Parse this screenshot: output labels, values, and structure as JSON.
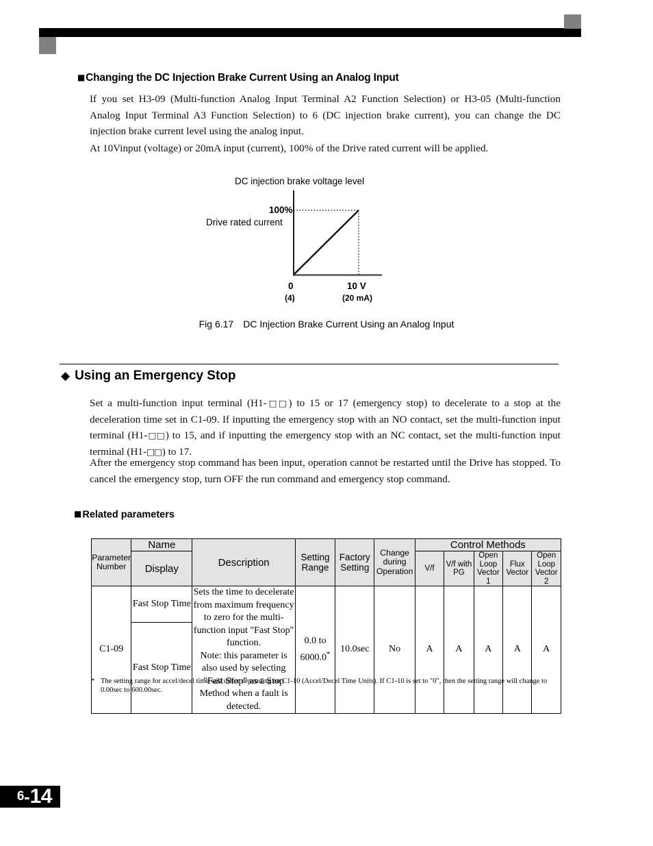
{
  "page": {
    "footer_chapter": "6",
    "footer_dash": "-",
    "footer_number": "14"
  },
  "section_analog": {
    "heading": "Changing the DC Injection Brake Current Using an Analog Input",
    "paragraph_1": "If you set H3-09 (Multi-function Analog Input Terminal A2 Function Selection) or H3-05 (Multi-function Analog Input Terminal A3 Function Selection) to 6 (DC injection brake current), you can change the DC injection brake current level using the analog input.",
    "paragraph_2": "At 10Vinput (voltage) or 20mA input (current), 100% of the Drive rated current will be applied."
  },
  "figure": {
    "caption_number": "Fig 6.17",
    "caption_text": "DC Injection Brake Current Using an Analog Input",
    "title": "DC injection brake voltage level",
    "y_label_value": "100%",
    "y_label_text": "Drive rated current",
    "x_label_0": "0",
    "x_label_0_alt": "(4)",
    "x_label_max": "10  V",
    "x_label_max_alt": "(20 mA)"
  },
  "chart_data": {
    "type": "line",
    "title": "DC injection brake voltage level",
    "xlabel": "",
    "ylabel": "Drive rated current",
    "x": [
      0,
      10
    ],
    "values": [
      0,
      100
    ],
    "xlim": [
      0,
      13
    ],
    "ylim": [
      0,
      115
    ],
    "x_tick_labels": [
      "0",
      "10  V"
    ],
    "x_tick_sublabels": [
      "(4)",
      "(20 mA)"
    ],
    "y_tick_labels": [
      "100%"
    ],
    "grid": false,
    "legend": "none",
    "annotations": [
      "Dotted guide line horizontal from 100% to the 10 V point",
      "Dotted guide line vertical from 10 V on the x-axis up to the 100% point"
    ]
  },
  "section_estop": {
    "heading": "Using an Emergency Stop",
    "paragraph_1_a": "Set a multi-function input terminal (H1-",
    "paragraph_1_b": ") to 15 or 17 (emergency stop) to decelerate to a stop at the deceleration time set in C1-09. If inputting the emergency stop with an NO contact, set the multi-function input terminal (H1-",
    "paragraph_1_c": ") to 15, and if inputting the emergency stop with an NC contact, set the multi-function input terminal (H1-",
    "paragraph_1_d": ") to 17.",
    "box_symbol": "□□",
    "paragraph_2": "After the emergency stop command has been input, operation cannot be restarted until the Drive has stopped. To cancel the emergency stop, turn OFF the run command and emergency stop command."
  },
  "related": {
    "heading": "Related parameters",
    "table": {
      "headers": {
        "parameter_number": "Parameter\nNumber",
        "name": "Name",
        "display": "Display",
        "description": "Description",
        "setting_range": "Setting\nRange",
        "factory_setting": "Factory\nSetting",
        "change_during_operation": "Change\nduring\nOperation",
        "control_methods": "Control Methods",
        "control_method_cols": [
          "V/f",
          "V/f with\nPG",
          "Open\nLoop\nVector\n1",
          "Flux\nVector",
          "Open\nLoop\nVector\n2"
        ]
      },
      "rows": [
        {
          "parameter_number": "C1-09",
          "name": "Fast Stop Time",
          "display": "Fast Stop Time",
          "description": "Sets the time to decelerate from maximum frequency to zero for the multi-function input \"Fast Stop\" function.\nNote: this parameter is also used by selecting \"Fast Stop\" as a Stop Method when a fault is detected.",
          "setting_range": "0.0 to\n6000.0",
          "setting_range_footnote": "*",
          "factory_setting": "10.0sec",
          "change_during_operation": "No",
          "control_methods": [
            "A",
            "A",
            "A",
            "A",
            "A"
          ]
        }
      ]
    },
    "footnote_marker": "*",
    "footnote_text": "The setting range for accel/decel time will differ depending on C1-10 (Accel/Decel Time Units).  If C1-10 is set to \"0\", then the setting range will change to 0.00sec to 600.00sec."
  },
  "colors": {
    "header_fill": "#e3e3e3",
    "bar_black": "#000000",
    "decoration_gray": "#808080",
    "axis_gray": "#6e6e6e"
  }
}
